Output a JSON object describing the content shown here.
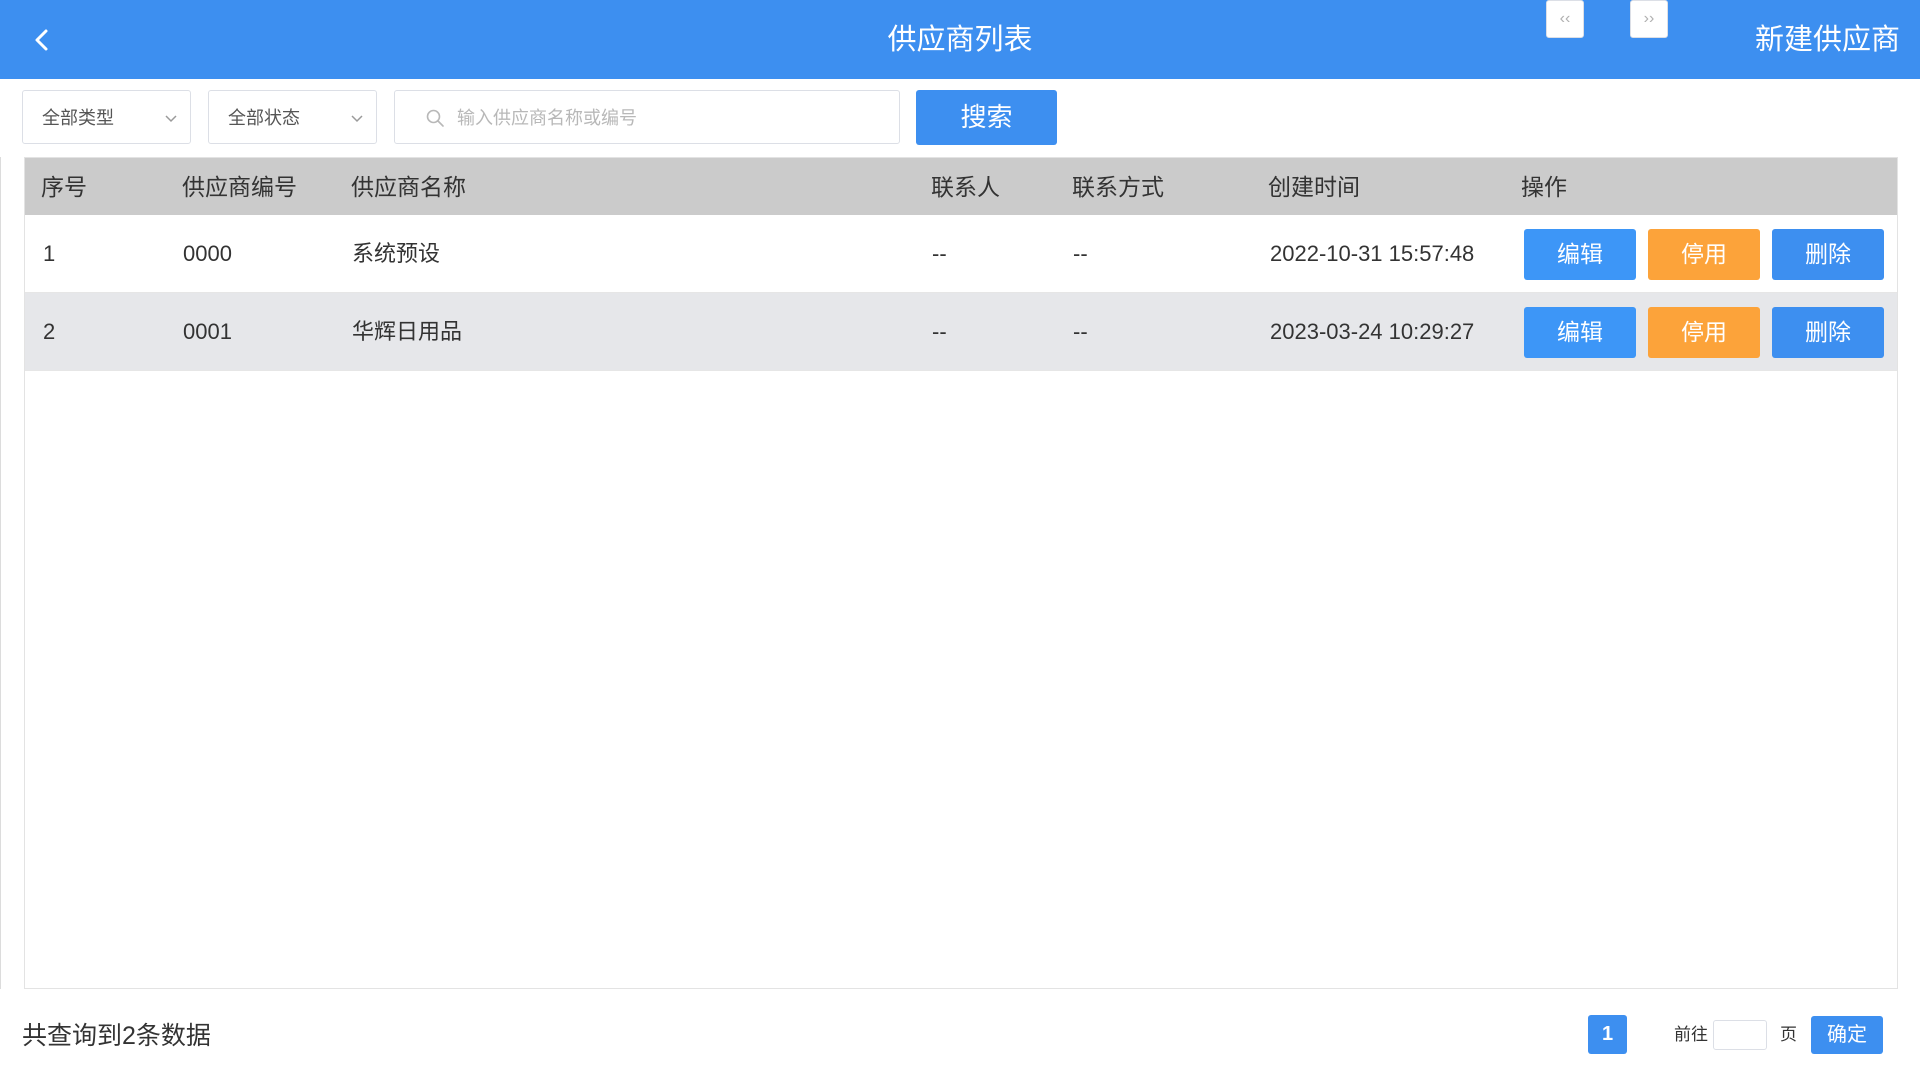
{
  "header": {
    "title": "供应商列表",
    "new_button_label": "新建供应商",
    "back_icon": "chevron-left-icon"
  },
  "filters": {
    "type_select": {
      "selected": "全部类型"
    },
    "status_select": {
      "selected": "全部状态"
    },
    "search": {
      "placeholder": "输入供应商名称或编号",
      "value": ""
    },
    "search_button_label": "搜索"
  },
  "table": {
    "columns": [
      "序号",
      "供应商编号",
      "供应商名称",
      "联系人",
      "联系方式",
      "创建时间",
      "操作"
    ],
    "rows": [
      {
        "index": "1",
        "code": "0000",
        "name": "系统预设",
        "contact": "--",
        "phone": "--",
        "created": "2022-10-31 15:57:48",
        "edit": "编辑",
        "disable": "停用",
        "delete": "删除"
      },
      {
        "index": "2",
        "code": "0001",
        "name": "华辉日用品",
        "contact": "--",
        "phone": "--",
        "created": "2023-03-24 10:29:27",
        "edit": "编辑",
        "disable": "停用",
        "delete": "删除"
      }
    ]
  },
  "footer": {
    "total_text": "共查询到2条数据",
    "pagination": {
      "prev": "‹‹",
      "current_page": "1",
      "next": "››",
      "goto_label": "前往",
      "goto_value": "",
      "page_unit": "页",
      "confirm_label": "确定"
    }
  },
  "colors": {
    "primary": "#3d8ff0",
    "warning": "#fca33a",
    "header_row": "#cbcbcb",
    "striped_row": "#e6e7ea"
  }
}
